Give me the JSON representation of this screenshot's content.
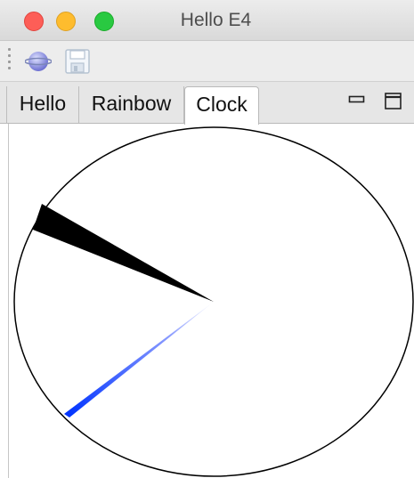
{
  "window": {
    "title": "Hello E4",
    "controls": [
      "close",
      "minimize",
      "zoom"
    ]
  },
  "toolbar": {
    "items": [
      {
        "icon": "hello-globe-icon"
      },
      {
        "icon": "save-icon",
        "disabled": true
      }
    ]
  },
  "tabs": {
    "items": [
      {
        "label": "Hello",
        "active": false
      },
      {
        "label": "Rainbow",
        "active": false
      },
      {
        "label": "Clock",
        "active": true
      }
    ],
    "controls": [
      "minimize-icon",
      "maximize-icon"
    ]
  },
  "clock": {
    "face_color": "#000000",
    "hour_hand_color": "#000000",
    "second_hand_color": "#0033ff"
  }
}
